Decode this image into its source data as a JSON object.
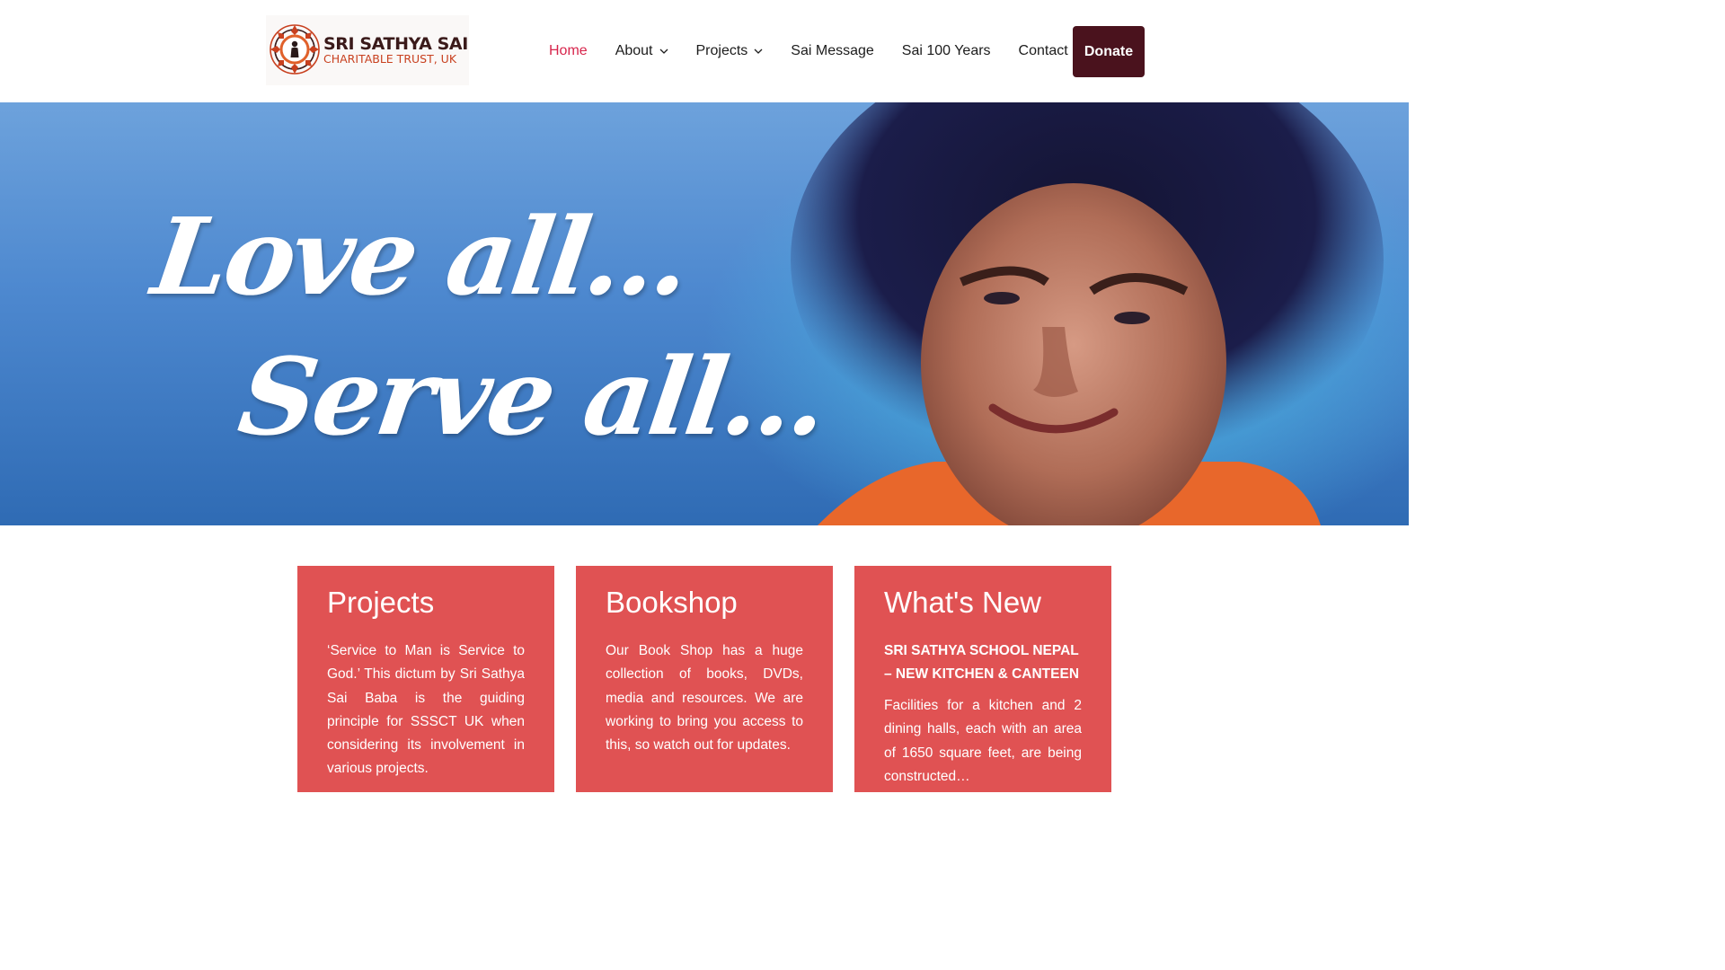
{
  "brand": {
    "name_line1": "SRI SATHYA SAI",
    "name_line2": "CHARITABLE TRUST, UK",
    "colors": {
      "primary": "#3a1a1a",
      "accent": "#c8401f"
    }
  },
  "nav": {
    "items": [
      {
        "label": "Home",
        "active": true,
        "has_dropdown": false
      },
      {
        "label": "About",
        "active": false,
        "has_dropdown": true
      },
      {
        "label": "Projects",
        "active": false,
        "has_dropdown": true
      },
      {
        "label": "Sai Message",
        "active": false,
        "has_dropdown": false
      },
      {
        "label": "Sai 100 Years",
        "active": false,
        "has_dropdown": false
      },
      {
        "label": "Contact",
        "active": false,
        "has_dropdown": false
      }
    ],
    "donate_label": "Donate",
    "active_color": "#d7254c",
    "donate_color": "#4a121d"
  },
  "hero": {
    "line1": "Love all...",
    "line2": "Serve all..."
  },
  "cards": [
    {
      "title": "Projects",
      "body": "‘Service to Man is Service to God.’ This dictum by Sri Sathya Sai Baba is the guiding principle for SSSCT UK when considering its involvement in various projects."
    },
    {
      "title": "Bookshop",
      "body": "Our Book Shop has a huge collection of books, DVDs, media and resources. We are working to bring you access to this, so watch out for updates."
    },
    {
      "title": "What's New",
      "subtitle": "SRI SATHYA SCHOOL NEPAL – NEW KITCHEN & CANTEEN",
      "body": "Facilities for a kitchen and 2 dining halls, each with an area of 1650 square feet, are being constructed…"
    }
  ],
  "card_color": "#e05253"
}
